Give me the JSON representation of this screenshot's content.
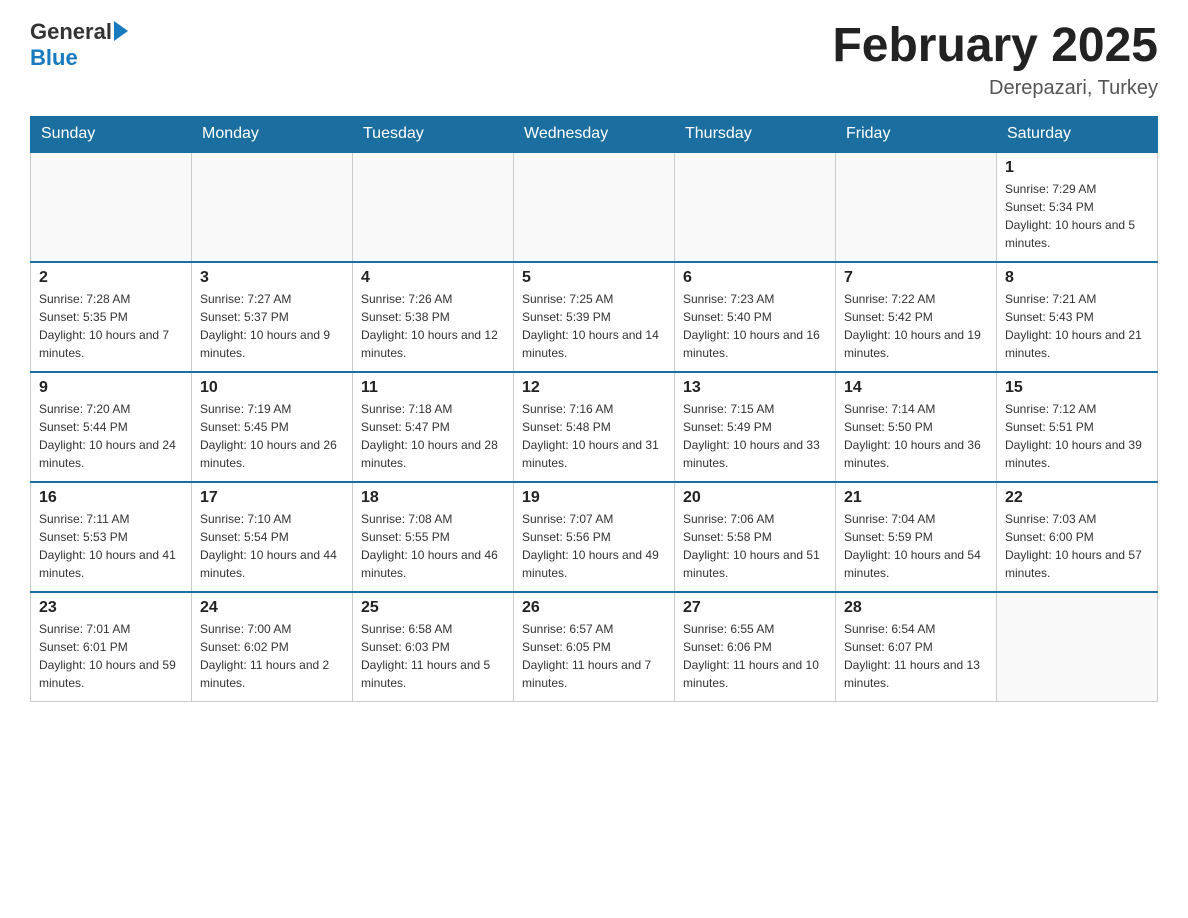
{
  "header": {
    "logo_general": "General",
    "logo_blue": "Blue",
    "title": "February 2025",
    "subtitle": "Derepazari, Turkey"
  },
  "days_of_week": [
    "Sunday",
    "Monday",
    "Tuesday",
    "Wednesday",
    "Thursday",
    "Friday",
    "Saturday"
  ],
  "weeks": [
    [
      {
        "num": "",
        "info": ""
      },
      {
        "num": "",
        "info": ""
      },
      {
        "num": "",
        "info": ""
      },
      {
        "num": "",
        "info": ""
      },
      {
        "num": "",
        "info": ""
      },
      {
        "num": "",
        "info": ""
      },
      {
        "num": "1",
        "info": "Sunrise: 7:29 AM\nSunset: 5:34 PM\nDaylight: 10 hours and 5 minutes."
      }
    ],
    [
      {
        "num": "2",
        "info": "Sunrise: 7:28 AM\nSunset: 5:35 PM\nDaylight: 10 hours and 7 minutes."
      },
      {
        "num": "3",
        "info": "Sunrise: 7:27 AM\nSunset: 5:37 PM\nDaylight: 10 hours and 9 minutes."
      },
      {
        "num": "4",
        "info": "Sunrise: 7:26 AM\nSunset: 5:38 PM\nDaylight: 10 hours and 12 minutes."
      },
      {
        "num": "5",
        "info": "Sunrise: 7:25 AM\nSunset: 5:39 PM\nDaylight: 10 hours and 14 minutes."
      },
      {
        "num": "6",
        "info": "Sunrise: 7:23 AM\nSunset: 5:40 PM\nDaylight: 10 hours and 16 minutes."
      },
      {
        "num": "7",
        "info": "Sunrise: 7:22 AM\nSunset: 5:42 PM\nDaylight: 10 hours and 19 minutes."
      },
      {
        "num": "8",
        "info": "Sunrise: 7:21 AM\nSunset: 5:43 PM\nDaylight: 10 hours and 21 minutes."
      }
    ],
    [
      {
        "num": "9",
        "info": "Sunrise: 7:20 AM\nSunset: 5:44 PM\nDaylight: 10 hours and 24 minutes."
      },
      {
        "num": "10",
        "info": "Sunrise: 7:19 AM\nSunset: 5:45 PM\nDaylight: 10 hours and 26 minutes."
      },
      {
        "num": "11",
        "info": "Sunrise: 7:18 AM\nSunset: 5:47 PM\nDaylight: 10 hours and 28 minutes."
      },
      {
        "num": "12",
        "info": "Sunrise: 7:16 AM\nSunset: 5:48 PM\nDaylight: 10 hours and 31 minutes."
      },
      {
        "num": "13",
        "info": "Sunrise: 7:15 AM\nSunset: 5:49 PM\nDaylight: 10 hours and 33 minutes."
      },
      {
        "num": "14",
        "info": "Sunrise: 7:14 AM\nSunset: 5:50 PM\nDaylight: 10 hours and 36 minutes."
      },
      {
        "num": "15",
        "info": "Sunrise: 7:12 AM\nSunset: 5:51 PM\nDaylight: 10 hours and 39 minutes."
      }
    ],
    [
      {
        "num": "16",
        "info": "Sunrise: 7:11 AM\nSunset: 5:53 PM\nDaylight: 10 hours and 41 minutes."
      },
      {
        "num": "17",
        "info": "Sunrise: 7:10 AM\nSunset: 5:54 PM\nDaylight: 10 hours and 44 minutes."
      },
      {
        "num": "18",
        "info": "Sunrise: 7:08 AM\nSunset: 5:55 PM\nDaylight: 10 hours and 46 minutes."
      },
      {
        "num": "19",
        "info": "Sunrise: 7:07 AM\nSunset: 5:56 PM\nDaylight: 10 hours and 49 minutes."
      },
      {
        "num": "20",
        "info": "Sunrise: 7:06 AM\nSunset: 5:58 PM\nDaylight: 10 hours and 51 minutes."
      },
      {
        "num": "21",
        "info": "Sunrise: 7:04 AM\nSunset: 5:59 PM\nDaylight: 10 hours and 54 minutes."
      },
      {
        "num": "22",
        "info": "Sunrise: 7:03 AM\nSunset: 6:00 PM\nDaylight: 10 hours and 57 minutes."
      }
    ],
    [
      {
        "num": "23",
        "info": "Sunrise: 7:01 AM\nSunset: 6:01 PM\nDaylight: 10 hours and 59 minutes."
      },
      {
        "num": "24",
        "info": "Sunrise: 7:00 AM\nSunset: 6:02 PM\nDaylight: 11 hours and 2 minutes."
      },
      {
        "num": "25",
        "info": "Sunrise: 6:58 AM\nSunset: 6:03 PM\nDaylight: 11 hours and 5 minutes."
      },
      {
        "num": "26",
        "info": "Sunrise: 6:57 AM\nSunset: 6:05 PM\nDaylight: 11 hours and 7 minutes."
      },
      {
        "num": "27",
        "info": "Sunrise: 6:55 AM\nSunset: 6:06 PM\nDaylight: 11 hours and 10 minutes."
      },
      {
        "num": "28",
        "info": "Sunrise: 6:54 AM\nSunset: 6:07 PM\nDaylight: 11 hours and 13 minutes."
      },
      {
        "num": "",
        "info": ""
      }
    ]
  ]
}
